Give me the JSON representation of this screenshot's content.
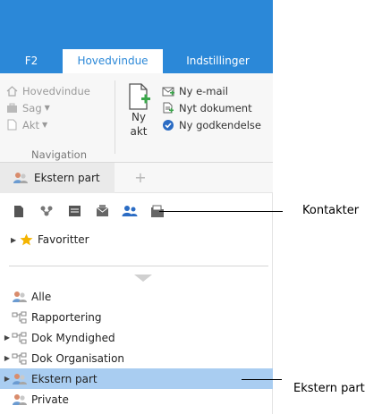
{
  "ribbon": {
    "tabs": [
      {
        "label": "F2"
      },
      {
        "label": "Hovedvindue"
      },
      {
        "label": "Indstillinger"
      }
    ],
    "navigation": {
      "items": [
        {
          "label": "Hovedvindue",
          "icon": "home-icon"
        },
        {
          "label": "Sag",
          "icon": "case-icon"
        },
        {
          "label": "Akt",
          "icon": "document-icon"
        }
      ],
      "group_label": "Navigation"
    },
    "new_act": {
      "line1": "Ny",
      "line2": "akt"
    },
    "actions": [
      {
        "label": "Ny e-mail",
        "icon": "new-email-icon"
      },
      {
        "label": "Nyt dokument",
        "icon": "new-document-icon"
      },
      {
        "label": "Ny godkendelse",
        "icon": "approval-icon"
      }
    ]
  },
  "doc_tab": {
    "label": "Ekstern part",
    "plus": "+"
  },
  "toolbar_icons": [
    "document-icon",
    "org-icon",
    "list-icon",
    "email-icon",
    "contacts-icon",
    "folder-icon"
  ],
  "favorites": {
    "label": "Favoritter"
  },
  "tree": [
    {
      "label": "Alle",
      "icon": "people-icon",
      "expandable": false,
      "selected": false
    },
    {
      "label": "Rapportering",
      "icon": "hierarchy-icon",
      "expandable": false,
      "selected": false
    },
    {
      "label": "Dok Myndighed",
      "icon": "hierarchy-icon",
      "expandable": true,
      "selected": false
    },
    {
      "label": "Dok Organisation",
      "icon": "hierarchy-icon",
      "expandable": true,
      "selected": false
    },
    {
      "label": "Ekstern part",
      "icon": "people-icon",
      "expandable": true,
      "selected": true
    },
    {
      "label": "Private",
      "icon": "people-icon",
      "expandable": false,
      "selected": false
    }
  ],
  "callouts": {
    "kontakter": "Kontakter",
    "ekstern_part": "Ekstern part"
  },
  "colors": {
    "ribbon_blue": "#2b88d8",
    "selection": "#a9cdf1",
    "star": "#f4b400",
    "green_plus": "#3aa64a"
  }
}
